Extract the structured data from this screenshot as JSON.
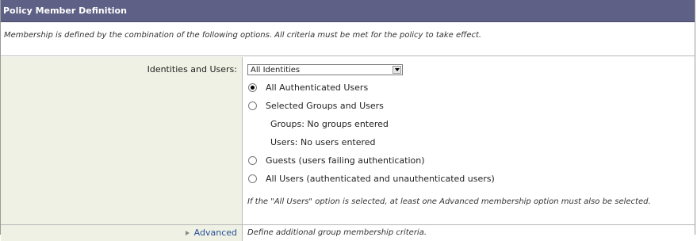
{
  "header": {
    "title": "Policy Member Definition"
  },
  "intro": {
    "text": "Membership is defined by the combination of the following options. All criteria must be met for the policy to take effect."
  },
  "identities": {
    "label": "Identities and Users:",
    "select_value": "All Identities",
    "options": [
      {
        "label": "All Authenticated Users",
        "checked": true
      },
      {
        "label": "Selected Groups and Users",
        "checked": false
      },
      {
        "label": "Guests (users failing authentication)",
        "checked": false
      },
      {
        "label": "All Users (authenticated and unauthenticated users)",
        "checked": false
      }
    ],
    "groups_text": "Groups: No groups entered",
    "users_text": "Users: No users entered",
    "note": "If the \"All Users\" option is selected, at least one Advanced membership option must also be selected."
  },
  "advanced": {
    "label": "Advanced",
    "description": "Define additional group membership criteria."
  },
  "colors": {
    "header_bg": "#5e6185",
    "label_bg": "#eef1e3",
    "link": "#2a4f9b"
  }
}
